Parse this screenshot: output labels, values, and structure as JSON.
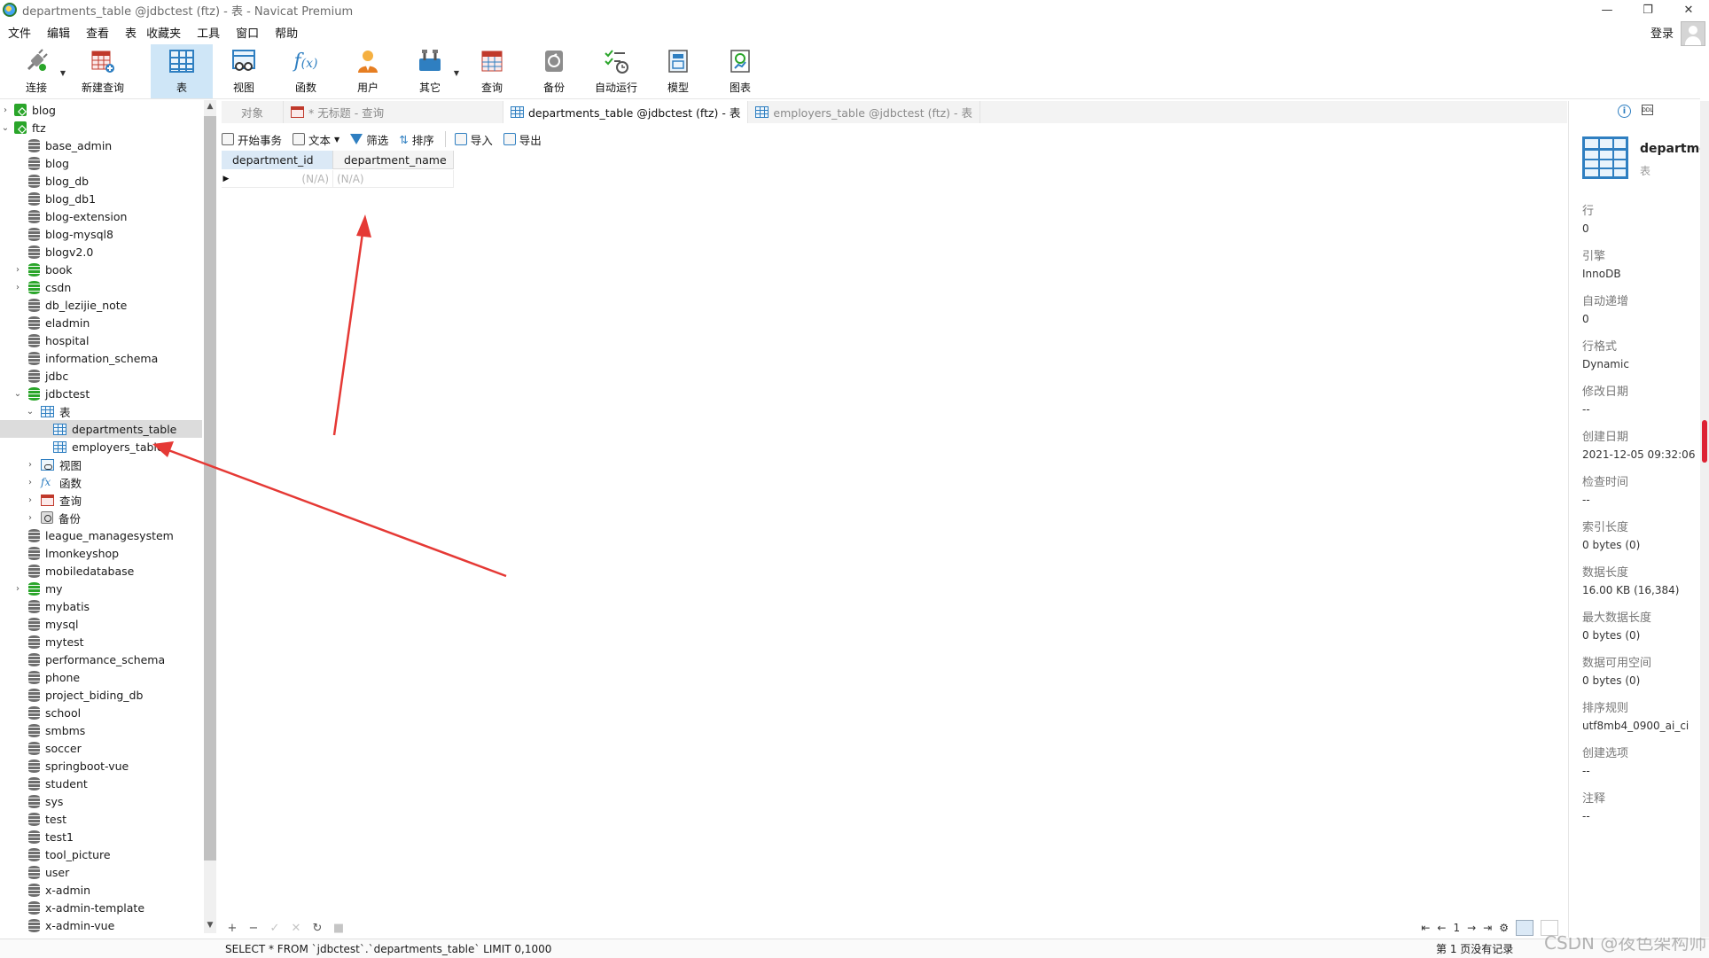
{
  "window": {
    "title": "departments_table @jdbctest (ftz) - 表 - Navicat Premium",
    "controls": [
      "—",
      "❐",
      "✕"
    ]
  },
  "menu": {
    "items": [
      "文件",
      "编辑",
      "查看",
      "表",
      "收藏夹",
      "工具",
      "窗口",
      "帮助"
    ],
    "login": "登录"
  },
  "toolbar": {
    "items": [
      {
        "label": "连接",
        "icon": "plug-icon"
      },
      {
        "label": "新建查询",
        "icon": "new-query-icon"
      },
      {
        "label": "表",
        "icon": "table-icon"
      },
      {
        "label": "视图",
        "icon": "view-icon"
      },
      {
        "label": "函数",
        "icon": "function-icon"
      },
      {
        "label": "用户",
        "icon": "user-icon"
      },
      {
        "label": "其它",
        "icon": "tools-icon"
      },
      {
        "label": "查询",
        "icon": "query-icon"
      },
      {
        "label": "备份",
        "icon": "backup-icon"
      },
      {
        "label": "自动运行",
        "icon": "schedule-icon"
      },
      {
        "label": "模型",
        "icon": "model-icon"
      },
      {
        "label": "图表",
        "icon": "chart-icon"
      }
    ]
  },
  "tree": {
    "blog_conn": "blog",
    "ftz_conn": "ftz",
    "databases_top": [
      "base_admin",
      "blog",
      "blog_db",
      "blog_db1",
      "blog-extension",
      "blog-mysql8",
      "blogv2.0",
      "book",
      "csdn",
      "db_lezijie_note",
      "eladmin",
      "hospital",
      "information_schema",
      "jdbc",
      "jdbctest"
    ],
    "jdbctest_children": {
      "tables_folder": "表",
      "tables": [
        "departments_table",
        "employers_table"
      ],
      "views_folder": "视图",
      "functions_folder": "函数",
      "queries_folder": "查询",
      "backups_folder": "备份"
    },
    "databases_bottom": [
      "league_managesystem",
      "lmonkeyshop",
      "mobiledatabase",
      "my",
      "mybatis",
      "mysql",
      "mytest",
      "performance_schema",
      "phone",
      "project_biding_db",
      "school",
      "smbms",
      "soccer",
      "springboot-vue",
      "student",
      "sys",
      "test",
      "test1",
      "tool_picture",
      "user",
      "x-admin",
      "x-admin-template",
      "x-admin-vue"
    ]
  },
  "tabs": {
    "objects": "对象",
    "untitled": "* 无标题 - 查询",
    "departments": "departments_table @jdbctest (ftz) - 表",
    "employers": "employers_table @jdbctest (ftz) - 表"
  },
  "object_toolbar": {
    "begin_tx": "开始事务",
    "text": "文本",
    "filter": "筛选",
    "sort": "排序",
    "import": "导入",
    "export": "导出"
  },
  "grid": {
    "columns": [
      "department_id",
      "department_name"
    ],
    "rows": [
      [
        "(N/A)",
        "(N/A)"
      ]
    ]
  },
  "bottom": {
    "page_number": "1",
    "sql": "SELECT * FROM `jdbctest`.`departments_table` LIMIT 0,1000",
    "page_info": "第 1 页没有记录"
  },
  "info": {
    "name": "departme",
    "type": "表",
    "props": [
      {
        "k": "行",
        "v": "0"
      },
      {
        "k": "引擎",
        "v": "InnoDB"
      },
      {
        "k": "自动递增",
        "v": "0"
      },
      {
        "k": "行格式",
        "v": "Dynamic"
      },
      {
        "k": "修改日期",
        "v": "--"
      },
      {
        "k": "创建日期",
        "v": "2021-12-05 09:32:06"
      },
      {
        "k": "检查时间",
        "v": "--"
      },
      {
        "k": "索引长度",
        "v": "0 bytes (0)"
      },
      {
        "k": "数据长度",
        "v": "16.00 KB (16,384)"
      },
      {
        "k": "最大数据长度",
        "v": "0 bytes (0)"
      },
      {
        "k": "数据可用空间",
        "v": "0 bytes (0)"
      },
      {
        "k": "排序规则",
        "v": "utf8mb4_0900_ai_ci"
      },
      {
        "k": "创建选项",
        "v": "--"
      },
      {
        "k": "注释",
        "v": "--"
      }
    ]
  },
  "watermark": "CSDN @夜色架构师",
  "colors": {
    "accent": "#2f7fc1",
    "selected_tool": "#cfe6f7",
    "annotation_arrow": "#e53935",
    "db_green": "#2aa52a"
  }
}
